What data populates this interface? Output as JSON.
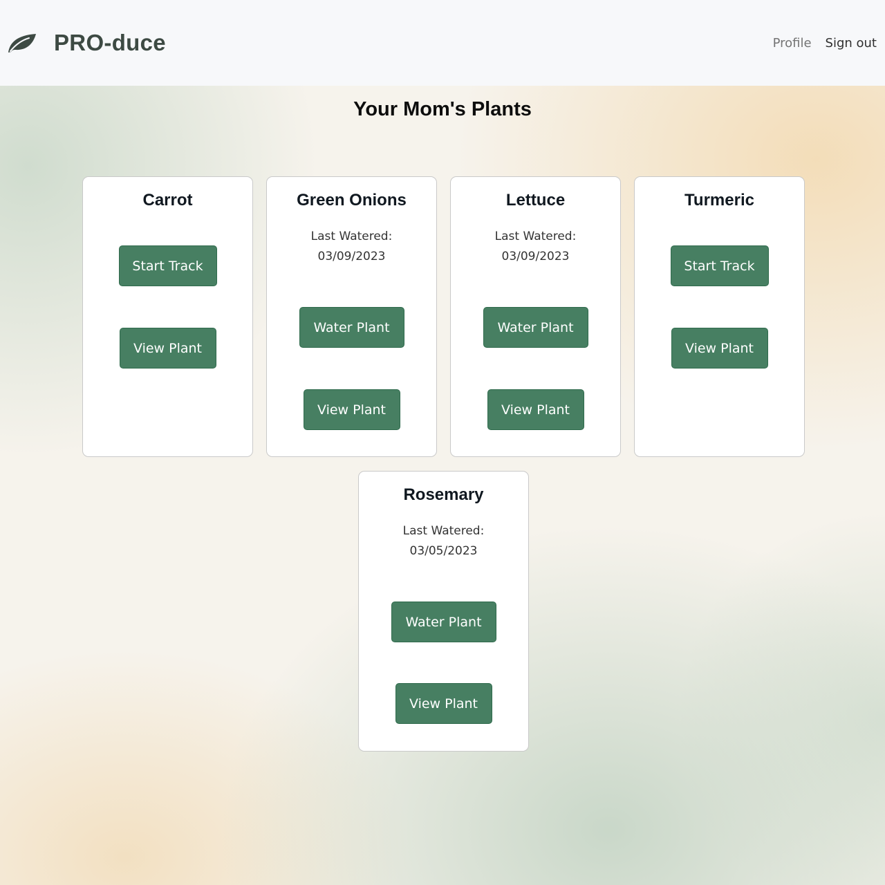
{
  "navbar": {
    "brand": "PRO-duce",
    "logo_icon": "leaf-icon",
    "profile_label": "Profile",
    "signout_label": "Sign out"
  },
  "page": {
    "title": "Your Mom's Plants"
  },
  "plants": [
    {
      "name": "Carrot",
      "start_label": "Start Track",
      "view_label": "View Plant"
    },
    {
      "name": "Green Onions",
      "watered_label": "Last Watered:",
      "watered_date": "03/09/2023",
      "water_label": "Water Plant",
      "view_label": "View Plant"
    },
    {
      "name": "Lettuce",
      "watered_label": "Last Watered:",
      "watered_date": "03/09/2023",
      "water_label": "Water Plant",
      "view_label": "View Plant"
    },
    {
      "name": "Turmeric",
      "start_label": "Start Track",
      "view_label": "View Plant"
    },
    {
      "name": "Rosemary",
      "watered_label": "Last Watered:",
      "watered_date": "03/05/2023",
      "water_label": "Water Plant",
      "view_label": "View Plant"
    }
  ],
  "colors": {
    "button": "#477f62",
    "navbar_bg": "#f7f8fa",
    "brand_text": "#3d4a43"
  }
}
